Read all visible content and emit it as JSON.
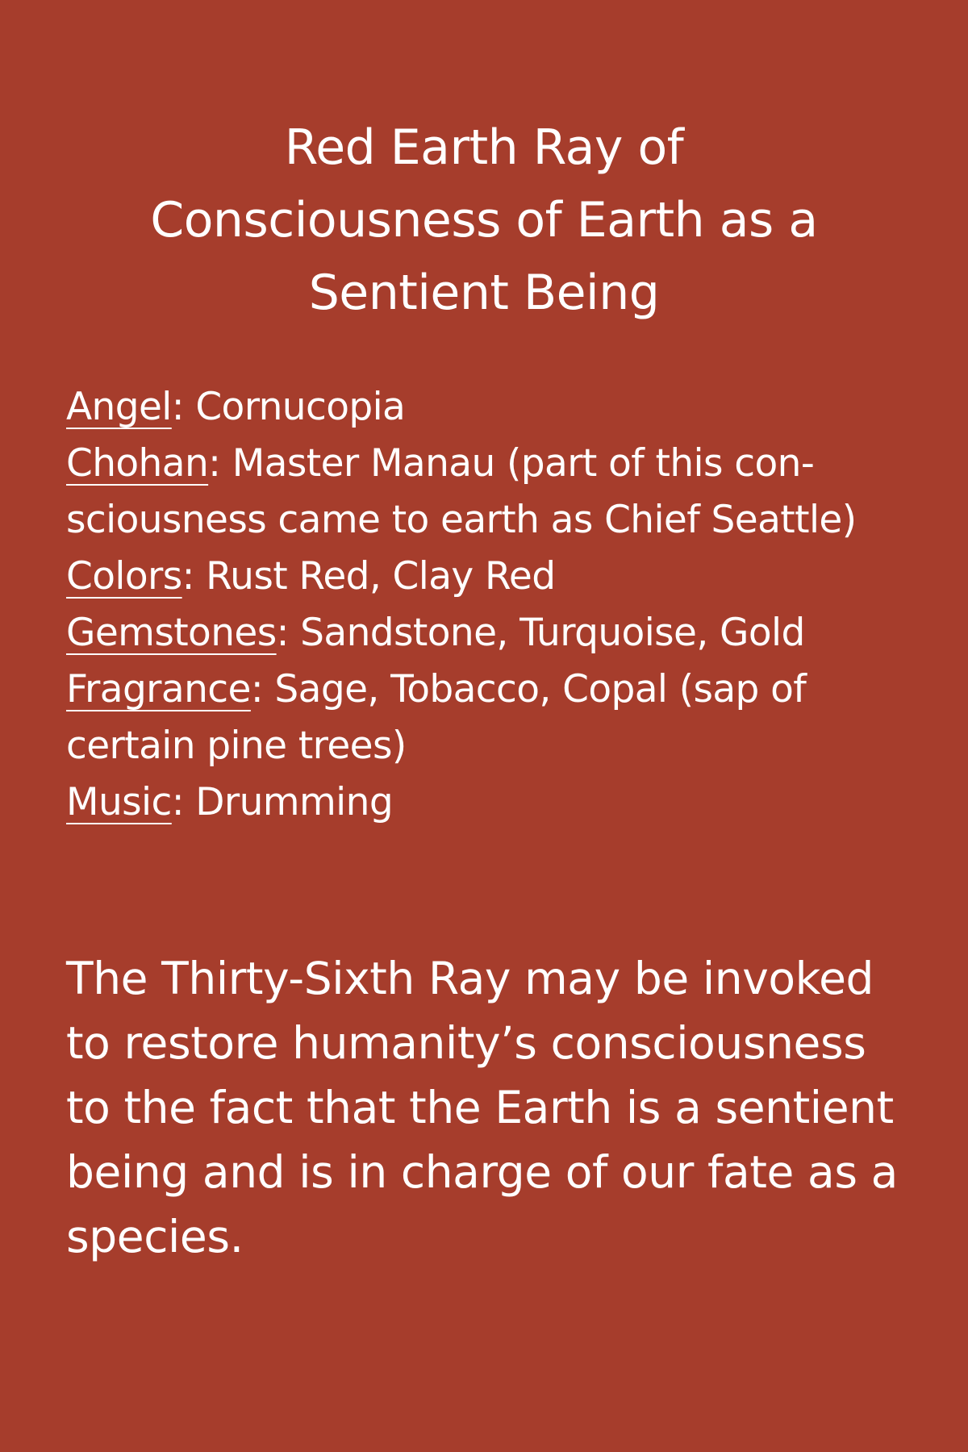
{
  "colors": {
    "background": "#a63d2c",
    "text": "#ffffff"
  },
  "title": {
    "lines": [
      "Red Earth Ray of",
      "Consciousness of Earth as a",
      "Sentient Being"
    ]
  },
  "attributes": [
    {
      "label": "Angel",
      "lines": [
        ": Cornucopia"
      ]
    },
    {
      "label": "Chohan",
      "lines": [
        ": Master Manau (part of this con-",
        "sciousness came to earth as Chief Seattle)"
      ]
    },
    {
      "label": "Colors",
      "lines": [
        ": Rust Red, Clay Red"
      ]
    },
    {
      "label": "Gemstones",
      "lines": [
        ": Sandstone, Turquoise, Gold"
      ]
    },
    {
      "label": "Fragrance",
      "lines": [
        ": Sage, Tobacco, Copal (sap of",
        "certain pine trees)"
      ]
    },
    {
      "label": "Music",
      "lines": [
        ": Drumming"
      ]
    }
  ],
  "description": {
    "lines": [
      "The Thirty-Sixth Ray may be invoked",
      "to restore humanity’s consciousness",
      "to the fact that the Earth is a sentient",
      "being and is in charge of our fate as a",
      "species."
    ]
  }
}
